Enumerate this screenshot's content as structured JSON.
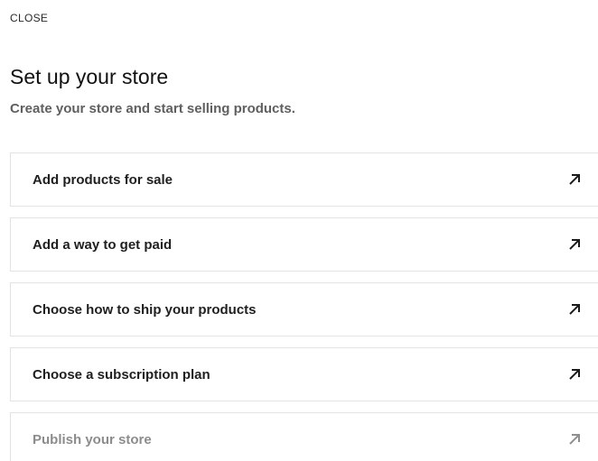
{
  "header": {
    "close_label": "CLOSE"
  },
  "main": {
    "title": "Set up your store",
    "subtitle": "Create your store and start selling products."
  },
  "tasks": [
    {
      "label": "Add products for sale",
      "icon": "external-arrow-icon",
      "enabled": true
    },
    {
      "label": "Add a way to get paid",
      "icon": "external-arrow-icon",
      "enabled": true
    },
    {
      "label": "Choose how to ship your products",
      "icon": "external-arrow-icon",
      "enabled": true
    },
    {
      "label": "Choose a subscription plan",
      "icon": "external-arrow-icon",
      "enabled": true
    },
    {
      "label": "Publish your store",
      "icon": "external-arrow-icon",
      "enabled": false
    }
  ],
  "colors": {
    "text_primary": "#1f1f1f",
    "text_muted": "#8c8c8c",
    "border": "#e3e3e3"
  }
}
